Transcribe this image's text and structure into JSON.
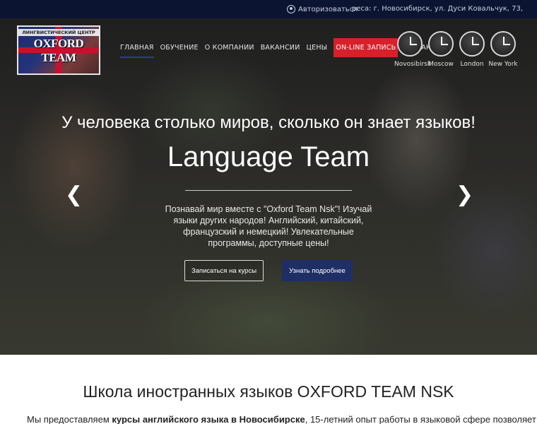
{
  "topbar": {
    "login_label": "Авторизоваться",
    "address": "реса: г. Новосибирск, ул. Дуси Ковальчук, 73,"
  },
  "logo": {
    "small_text": "ЛИНГВИСТИЧЕСКИЙ ЦЕНТР",
    "big_text": "OXFORD TEAM"
  },
  "nav": {
    "items": [
      {
        "label": "ГЛАВНАЯ"
      },
      {
        "label": "ОБУЧЕНИЕ"
      },
      {
        "label": "О КОМПАНИИ"
      },
      {
        "label": "ВАКАНСИИ"
      },
      {
        "label": "ЦЕНЫ"
      },
      {
        "label": "ON-LINE ЗАПИСЬ"
      },
      {
        "label": "КОНТАКТЫ"
      }
    ]
  },
  "clocks": [
    {
      "city": "Novosibirsk"
    },
    {
      "city": "Moscow"
    },
    {
      "city": "London"
    },
    {
      "city": "New York"
    }
  ],
  "hero": {
    "tagline": "У человека столько миров, сколько он знает языков!",
    "title": "Language Team",
    "description": "Познавай мир вместе с \"Oxford Team Nsk\"! Изучай языки других народов! Английский, китайский, французский и немецкий! Увлекательные программы, доступные цены!",
    "prev_glyph": "❮",
    "next_glyph": "❯",
    "btn_signup": "Записаться на курсы",
    "btn_more": "Узнать подробнее"
  },
  "section": {
    "heading": "Школа иностранных языков OXFORD TEAM NSK",
    "intro_pre": "Мы предоставляем ",
    "intro_bold": "курсы английского языка в Новосибирске",
    "intro_post": ", 15-летний опыт работы в языковой сфере позволяет"
  },
  "colors": {
    "topbar_bg": "#0b1430",
    "online_btn": "#d8202a",
    "more_btn": "#1f2f66"
  }
}
